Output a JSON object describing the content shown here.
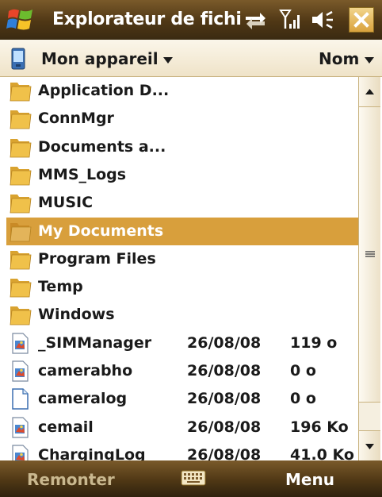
{
  "titlebar": {
    "title": "Explorateur de fichier",
    "icons": [
      "windows-start-icon",
      "sync-icon",
      "signal-icon",
      "volume-icon",
      "close-icon"
    ]
  },
  "location": {
    "label": "Mon appareil",
    "sort_label": "Nom",
    "icons": [
      "device-icon",
      "chevron-down-icon"
    ]
  },
  "files": [
    {
      "name": "Application D...",
      "type": "folder",
      "date": "",
      "size": "",
      "selected": false
    },
    {
      "name": "ConnMgr",
      "type": "folder",
      "date": "",
      "size": "",
      "selected": false
    },
    {
      "name": "Documents a...",
      "type": "folder",
      "date": "",
      "size": "",
      "selected": false
    },
    {
      "name": "MMS_Logs",
      "type": "folder",
      "date": "",
      "size": "",
      "selected": false
    },
    {
      "name": "MUSIC",
      "type": "folder",
      "date": "",
      "size": "",
      "selected": false
    },
    {
      "name": "My Documents",
      "type": "folder",
      "date": "",
      "size": "",
      "selected": true
    },
    {
      "name": "Program Files",
      "type": "folder",
      "date": "",
      "size": "",
      "selected": false
    },
    {
      "name": "Temp",
      "type": "folder",
      "date": "",
      "size": "",
      "selected": false
    },
    {
      "name": "Windows",
      "type": "folder",
      "date": "",
      "size": "",
      "selected": false
    },
    {
      "name": "_SIMManager",
      "type": "app",
      "date": "26/08/08",
      "size": "119 o",
      "selected": false
    },
    {
      "name": "camerabho",
      "type": "app",
      "date": "26/08/08",
      "size": "0 o",
      "selected": false
    },
    {
      "name": "cameralog",
      "type": "doc",
      "date": "26/08/08",
      "size": "0 o",
      "selected": false
    },
    {
      "name": "cemail",
      "type": "app",
      "date": "26/08/08",
      "size": "196 Ko",
      "selected": false
    },
    {
      "name": "ChargingLog",
      "type": "app",
      "date": "26/08/08",
      "size": "41.0 Ko",
      "selected": false
    }
  ],
  "softkeys": {
    "left": "Remonter",
    "right": "Menu",
    "center_icon": "keyboard-icon"
  },
  "colors": {
    "bar_dark": "#4f3715",
    "selection": "#d89f3c",
    "folder_yellow": "#f0c14a"
  }
}
